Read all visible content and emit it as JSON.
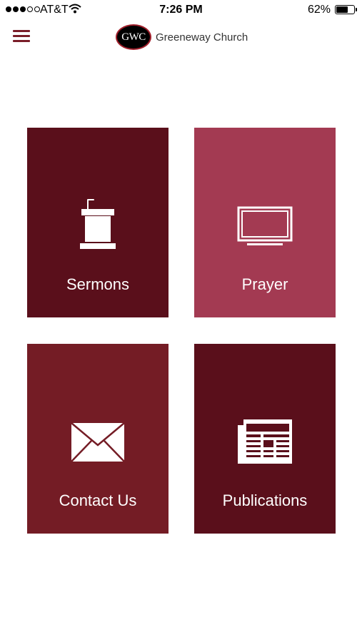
{
  "status_bar": {
    "carrier": "AT&T",
    "time": "7:26 PM",
    "battery": "62%",
    "signal_bars_full": 3,
    "signal_bars_total": 5,
    "battery_level": 0.62
  },
  "header": {
    "logo_text": "GWC",
    "title": "Greeneway Church",
    "menu_icon": "hamburger-menu-icon",
    "accent_color": "#7a1d28"
  },
  "tiles": [
    {
      "label": "Sermons",
      "icon": "podium-icon",
      "color": "#5a0f1b"
    },
    {
      "label": "Prayer",
      "icon": "monitor-icon",
      "color": "#a33a52"
    },
    {
      "label": "Contact Us",
      "icon": "envelope-icon",
      "color": "#741c25"
    },
    {
      "label": "Publications",
      "icon": "newspaper-icon",
      "color": "#5a0f1b"
    }
  ]
}
